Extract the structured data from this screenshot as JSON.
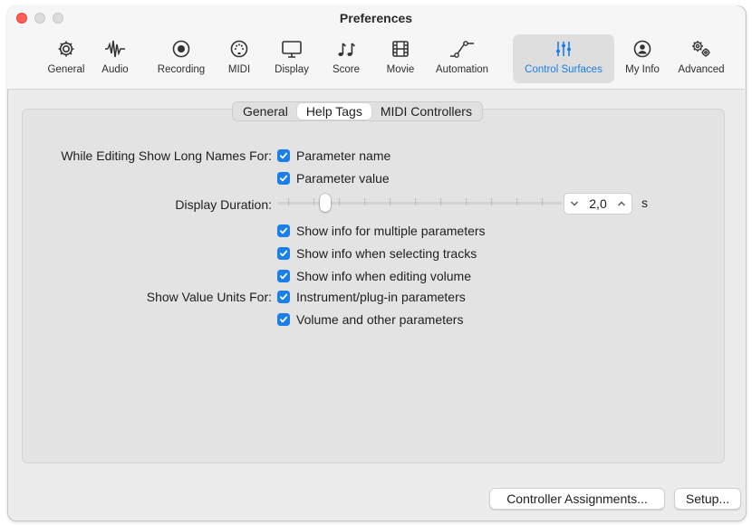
{
  "window": {
    "title": "Preferences"
  },
  "toolbar": {
    "items": [
      {
        "label": "General",
        "icon": "gear-icon"
      },
      {
        "label": "Audio",
        "icon": "waveform-icon"
      },
      {
        "label": "Recording",
        "icon": "record-icon"
      },
      {
        "label": "MIDI",
        "icon": "midi-port-icon"
      },
      {
        "label": "Display",
        "icon": "monitor-icon"
      },
      {
        "label": "Score",
        "icon": "music-notes-icon"
      },
      {
        "label": "Movie",
        "icon": "film-icon"
      },
      {
        "label": "Automation",
        "icon": "automation-curve-icon"
      },
      {
        "label": "Control Surfaces",
        "icon": "sliders-icon",
        "selected": true
      },
      {
        "label": "My Info",
        "icon": "person-icon"
      },
      {
        "label": "Advanced",
        "icon": "gears-icon"
      }
    ],
    "accent_color": "#1a7fe8"
  },
  "tabs": [
    {
      "label": "General",
      "selected": false
    },
    {
      "label": "Help Tags",
      "selected": true
    },
    {
      "label": "MIDI Controllers",
      "selected": false
    }
  ],
  "settings": {
    "long_names_label": "While Editing Show Long Names For:",
    "parameter_name": {
      "label": "Parameter name",
      "checked": true
    },
    "parameter_value": {
      "label": "Parameter value",
      "checked": true
    },
    "display_duration_label": "Display Duration:",
    "display_duration_value": "2,0",
    "display_duration_unit": "s",
    "display_duration_slider_position": 0.17,
    "multiple_params": {
      "label": "Show info for multiple parameters",
      "checked": true
    },
    "selecting_tracks": {
      "label": "Show info when selecting tracks",
      "checked": true
    },
    "editing_volume": {
      "label": "Show info when editing volume",
      "checked": true
    },
    "value_units_label": "Show Value Units For:",
    "instrument_params": {
      "label": "Instrument/plug-in parameters",
      "checked": true
    },
    "volume_params": {
      "label": "Volume and other parameters",
      "checked": true
    }
  },
  "buttons": {
    "controller_assignments": "Controller Assignments...",
    "setup": "Setup..."
  }
}
